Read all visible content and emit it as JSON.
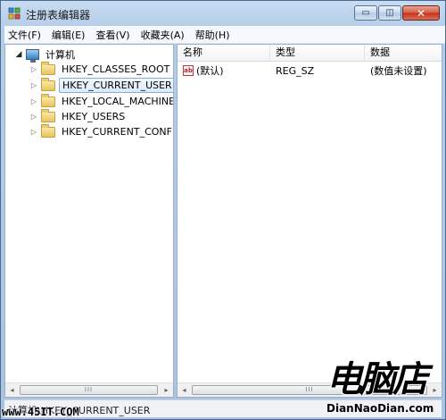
{
  "window": {
    "title": "注册表编辑器",
    "minimize_glyph": "▭",
    "maximize_glyph": "◫",
    "close_glyph": "✕"
  },
  "menu": [
    "文件(F)",
    "编辑(E)",
    "查看(V)",
    "收藏夹(A)",
    "帮助(H)"
  ],
  "tree": {
    "root": {
      "label": "计算机",
      "icon": "computer-icon",
      "expander": "◢"
    },
    "children": [
      {
        "label": "HKEY_CLASSES_ROOT",
        "expander": "▷",
        "selected": false
      },
      {
        "label": "HKEY_CURRENT_USER",
        "expander": "▷",
        "selected": true
      },
      {
        "label": "HKEY_LOCAL_MACHINE",
        "expander": "▷",
        "selected": false
      },
      {
        "label": "HKEY_USERS",
        "expander": "▷",
        "selected": false
      },
      {
        "label": "HKEY_CURRENT_CONFIG",
        "expander": "▷",
        "selected": false
      }
    ]
  },
  "list": {
    "columns": [
      "名称",
      "类型",
      "数据"
    ],
    "rows": [
      {
        "icon": "ab",
        "name": "(默认)",
        "type": "REG_SZ",
        "data": "(数值未设置)"
      }
    ]
  },
  "scrollbar": {
    "left_arrow": "◂",
    "right_arrow": "▸",
    "thumb_grip": "III"
  },
  "status": {
    "path": "计算机\\HKEY_CURRENT_USER"
  },
  "watermark": {
    "left_site": "www.45IT.COM",
    "brand": "电脑店",
    "brand_site": "DianNaoDian.com"
  },
  "colors": {
    "selection_border": "#84acdd",
    "close_button": "#c2331a",
    "string_value_icon": "#b8262a"
  }
}
